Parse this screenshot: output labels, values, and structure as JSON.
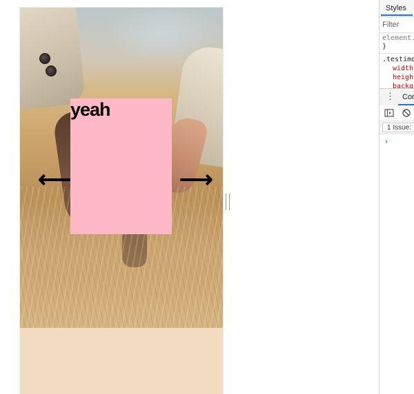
{
  "page": {
    "card_text": "yeah",
    "arrow_left": "⟵",
    "arrow_right": "⟶"
  },
  "devtools": {
    "styles_tab": "Styles",
    "filter_placeholder": "Filter",
    "rules": {
      "element_selector": "element.",
      "close_brace": "}",
      "testimo_selector": ".testimo",
      "prop_width": "width",
      "prop_height": "heigh",
      "prop_background": "backgr"
    },
    "drawer_tab": "Con",
    "issues_label": "1 Issue:",
    "prompt": "›"
  },
  "colors": {
    "card": "#ffb8c6",
    "below_section": "#f1dbc1",
    "accent": "#1a73e8",
    "css_property": "#c80000"
  },
  "icons": {
    "drawer_menu": "kebab-menu-icon",
    "sidebar_toggle": "sidebar-toggle-icon",
    "clear_console": "clear-console-icon"
  }
}
